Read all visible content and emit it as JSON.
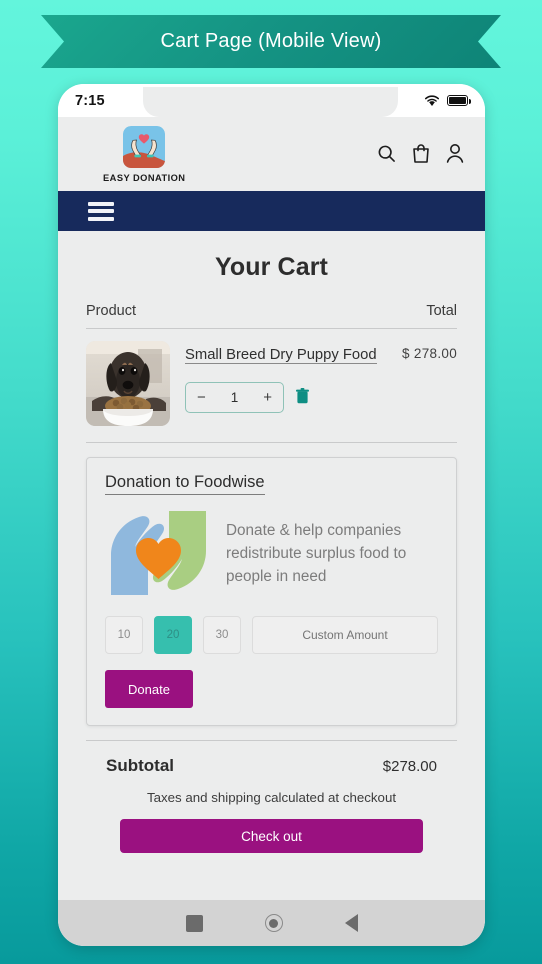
{
  "banner": {
    "title": "Cart Page (Mobile View)",
    "ribbon_color": "#159484"
  },
  "phone": {
    "status_bar": {
      "time": "7:15",
      "wifi_icon": "wifi-icon",
      "battery_icon": "battery-full-icon"
    },
    "header": {
      "logo_icon": "heart-in-hands-logo-icon",
      "brand_name": "EASY DONATION",
      "icons": [
        {
          "name": "search-icon",
          "label": "Search"
        },
        {
          "name": "shopping-bag-icon",
          "label": "Cart"
        },
        {
          "name": "user-account-icon",
          "label": "Account"
        }
      ]
    },
    "navbar": {
      "menu_icon": "hamburger-menu-icon",
      "background": "#172A5C"
    },
    "cart": {
      "page_title": "Your Cart",
      "columns": {
        "product": "Product",
        "total": "Total"
      },
      "items": [
        {
          "image": "dachshund-puppy-with-food-bowl-photo",
          "title": "Small Breed Dry Puppy Food",
          "price": "$ 278.00",
          "quantity": "1",
          "decrement_label": "−",
          "increment_label": "+",
          "remove_icon": "trash-icon"
        }
      ]
    },
    "donation": {
      "title": "Donation to Foodwise",
      "illustration_icon": "two-hands-holding-heart-icon",
      "description": "Donate & help companies redistribute surplus food to people in need",
      "amounts": [
        {
          "label": "10",
          "selected": false
        },
        {
          "label": "20",
          "selected": true
        },
        {
          "label": "30",
          "selected": false
        }
      ],
      "custom_amount_placeholder": "Custom Amount",
      "custom_amount_value": "",
      "donate_label": "Donate",
      "selected_color": "#36BFAE",
      "donate_color": "#9A1180"
    },
    "totals": {
      "subtotal_label": "Subtotal",
      "subtotal_value": "$278.00",
      "tax_note": "Taxes and shipping calculated at checkout",
      "checkout_label": "Check out",
      "checkout_color": "#9A1180"
    },
    "android_nav": {
      "recents_icon": "square-recents-icon",
      "home_icon": "circle-home-icon",
      "back_icon": "triangle-back-icon"
    }
  }
}
